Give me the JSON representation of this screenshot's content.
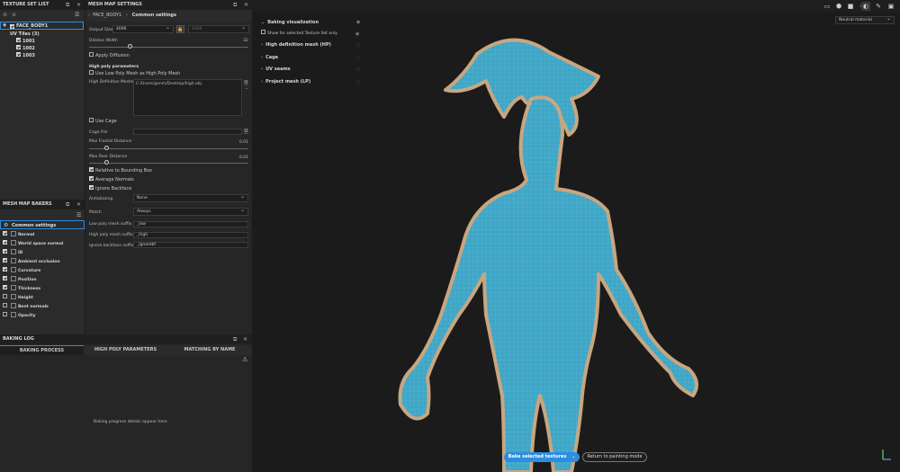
{
  "texture_set_list": {
    "title": "TEXTURE SET LIST",
    "items": [
      {
        "label": "FACE_BODY1"
      },
      {
        "label": "UV Tiles (3)"
      },
      {
        "label": "1001"
      },
      {
        "label": "1002"
      },
      {
        "label": "1003"
      }
    ]
  },
  "mesh_map_settings": {
    "title": "MESH MAP SETTINGS",
    "breadcrumb": [
      "FACE_BODY1",
      "Common settings"
    ],
    "output_size_label": "Output Size",
    "output_size_value": "4096",
    "output_size_locked": "4096",
    "dilation_label": "Dilation Width",
    "dilation_value": "32",
    "apply_diffusion": "Apply Diffusion",
    "high_poly_params": "High poly parameters",
    "use_low_poly": "Use Low Poly Mesh as High Poly Mesh",
    "hd_meshes_label": "High Definition Meshes",
    "hd_mesh_path": "C:/Users/genm/Desktop/high.obj",
    "use_cage": "Use Cage",
    "cage_file_label": "Cage File",
    "max_frontal_label": "Max Frontal Distance",
    "max_frontal_value": "0.01",
    "max_rear_label": "Max Rear Distance",
    "max_rear_value": "0.01",
    "relative_bbox": "Relative to Bounding Box",
    "average_normals": "Average Normals",
    "ignore_backface": "Ignore Backface",
    "antialiasing_label": "Antialiasing",
    "antialiasing_value": "None",
    "match_label": "Match",
    "match_value": "Always",
    "low_suffix_label": "Low poly mesh suffix",
    "low_suffix_value": "_low",
    "high_suffix_label": "High poly mesh suffix",
    "high_suffix_value": "_high",
    "ignore_suffix_label": "Ignore backface suffix",
    "ignore_suffix_value": "_ignorebf"
  },
  "mesh_map_bakers": {
    "title": "MESH MAP BAKERS",
    "common": "Common settings",
    "items": [
      {
        "label": "Normal",
        "checked": true
      },
      {
        "label": "World space normal",
        "checked": true
      },
      {
        "label": "ID",
        "checked": true
      },
      {
        "label": "Ambient occlusion",
        "checked": true
      },
      {
        "label": "Curvature",
        "checked": true
      },
      {
        "label": "Position",
        "checked": true
      },
      {
        "label": "Thickness",
        "checked": true
      },
      {
        "label": "Height",
        "checked": false
      },
      {
        "label": "Bent normals",
        "checked": false
      },
      {
        "label": "Opacity",
        "checked": false
      }
    ]
  },
  "baking_log": {
    "title": "BAKING LOG",
    "tabs": [
      "BAKING PROCESS",
      "HIGH POLY PARAMETERS",
      "MATCHING BY NAME"
    ],
    "message": "Baking progress details appear here."
  },
  "viewport": {
    "sections": [
      {
        "label": "Baking visualization"
      },
      {
        "label": "High definition mesh (HP)"
      },
      {
        "label": "Cage"
      },
      {
        "label": "UV seams"
      },
      {
        "label": "Project mesh (LP)"
      }
    ],
    "show_selected": "Show for selected Texture Set only",
    "material_dropdown": "Neutral material",
    "bake_button": "Bake selected textures",
    "return_button": "Return to painting mode"
  },
  "colors": {
    "mesh_blue": "#3fa6c6",
    "wire_tan": "#c9a57e",
    "accent": "#2d8de0"
  }
}
